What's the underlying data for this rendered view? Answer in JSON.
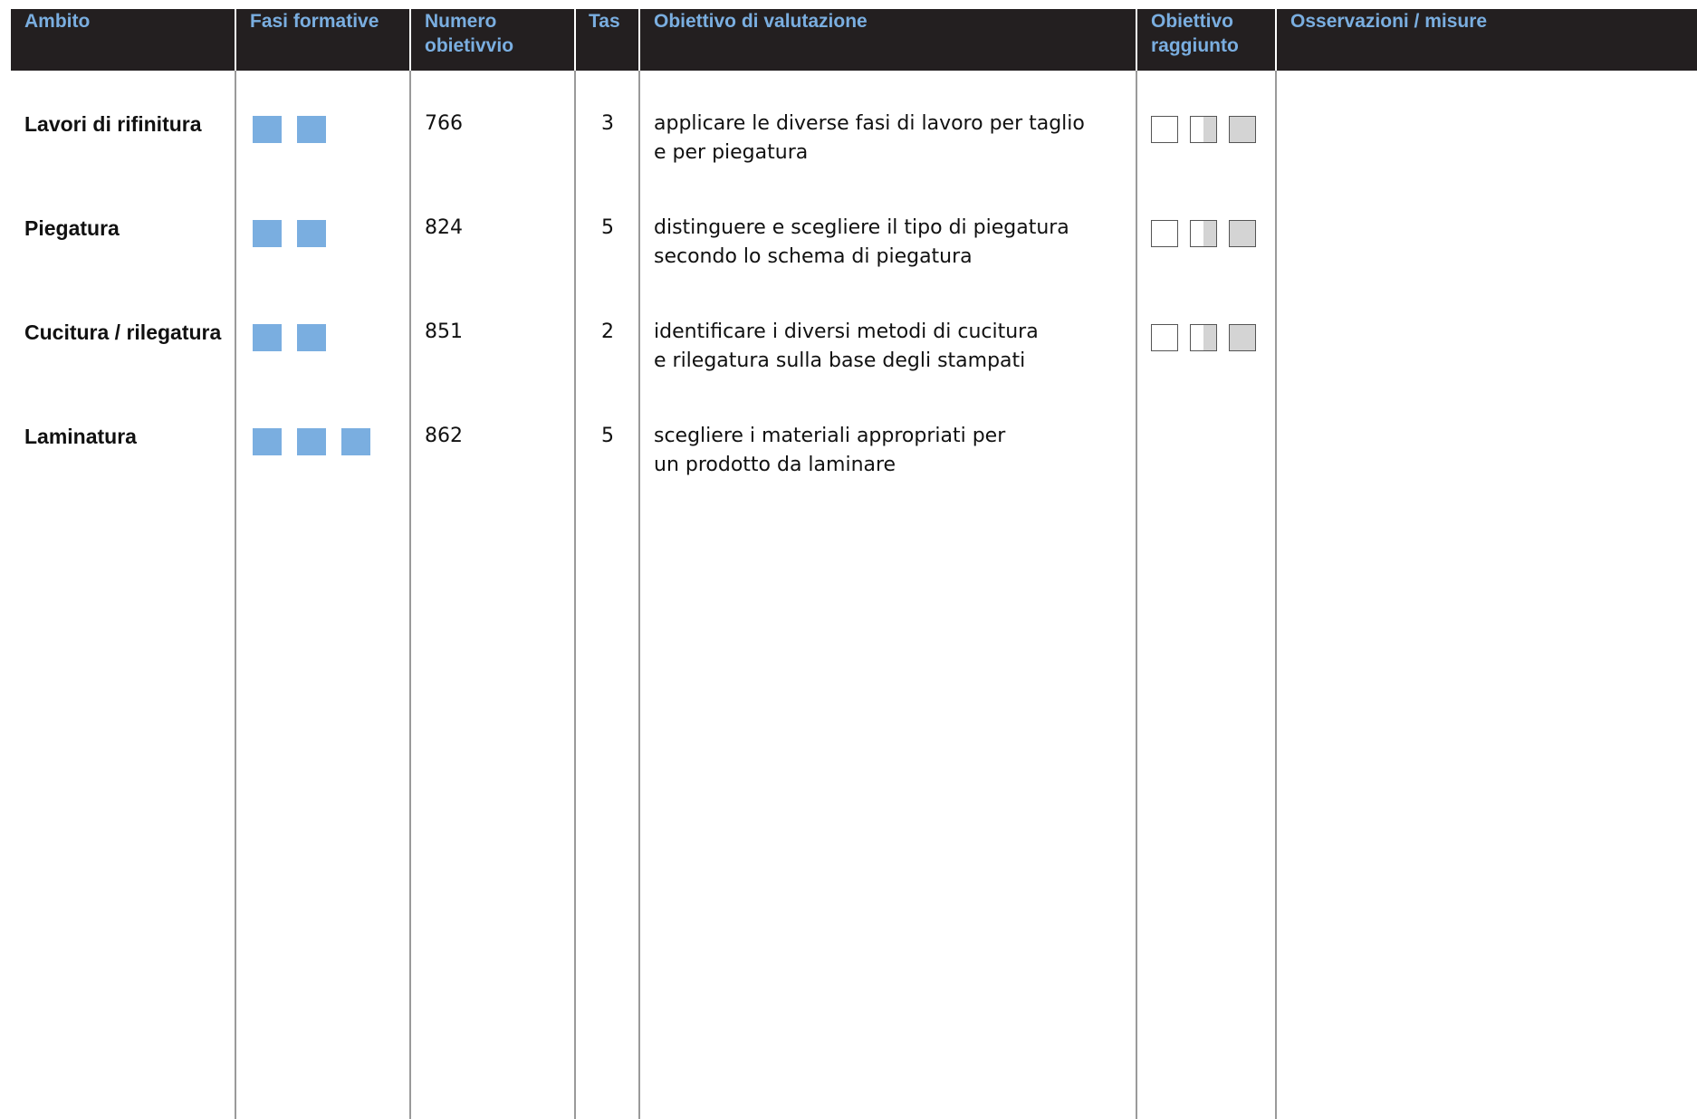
{
  "colors": {
    "header_bg": "#231f20",
    "header_text": "#7aaee0",
    "phase_square": "#7aaee0",
    "grid_line": "#9a9a9a",
    "check_fill": "#d4d4d4"
  },
  "header": {
    "ambito": "Ambito",
    "fasi": "Fasi formative",
    "numero_1": "Numero",
    "numero_2": "obietivvio",
    "tas": "Tas",
    "obiettivo_valutazione": "Obiettivo di valutazione",
    "raggiunto_1": "Obiettivo",
    "raggiunto_2": "raggiunto",
    "osservazioni": "Osservazioni / misure"
  },
  "rows": [
    {
      "ambito": "Lavori di rifinitura",
      "phases": 2,
      "numero": "766",
      "tas": "3",
      "obj_1": "applicare le diverse fasi di lavoro per taglio",
      "obj_2": "e per piegatura",
      "has_checks": true
    },
    {
      "ambito": "Piegatura",
      "phases": 2,
      "numero": "824",
      "tas": "5",
      "obj_1": "distinguere e scegliere il tipo di piegatura",
      "obj_2": "secondo lo schema di piegatura",
      "has_checks": true
    },
    {
      "ambito": "Cucitura / rilegatura",
      "phases": 2,
      "numero": "851",
      "tas": "2",
      "obj_1": "identificare i diversi metodi di cucitura",
      "obj_2": "e rilegatura sulla base degli stampati",
      "has_checks": true
    },
    {
      "ambito": "Laminatura",
      "phases": 3,
      "numero": "862",
      "tas": "5",
      "obj_1": "scegliere i materiali appropriati per",
      "obj_2": "un prodotto da laminare",
      "has_checks": false
    }
  ]
}
